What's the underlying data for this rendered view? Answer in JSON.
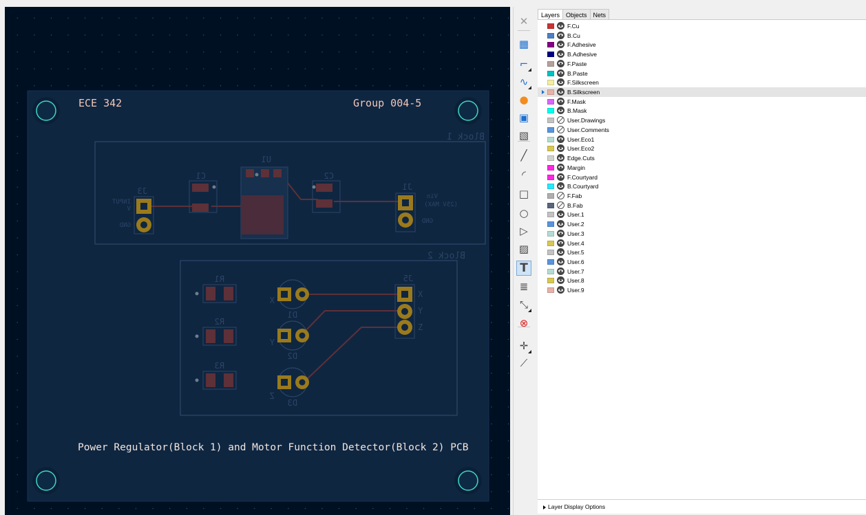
{
  "canvas": {
    "board": {
      "title_left": "ECE 342",
      "title_right": "Group 004-5",
      "footer": "Power Regulator(Block 1) and Motor Function Detector(Block 2) PCB",
      "block1_label": "Block 1",
      "block2_label": "Block 2",
      "refs": {
        "u1": "U1",
        "c1": "C1",
        "c2": "C2",
        "j3": "J3",
        "j1": "J1",
        "j5": "J5",
        "r1": "R1",
        "r2": "R2",
        "r3": "R3",
        "d1": "D1",
        "d2": "D2",
        "d3": "D3"
      },
      "pins": {
        "x": "X",
        "y": "Y",
        "z": "Z",
        "x_d1": "X",
        "y_d2": "Y",
        "z_d3": "Z"
      },
      "faint_labels": {
        "j3_input_1": "INPUT",
        "j3_input_2": "V",
        "j3_gnd": "GND",
        "j1_vin": "Vin",
        "j1_max": "(25V MAX)",
        "j1_gnd": "GND"
      }
    }
  },
  "toolbar": {
    "tools": [
      {
        "name": "select-tool-icon",
        "glyph": "✕"
      },
      {
        "name": "footprint-tool-icon",
        "glyph": "▦"
      },
      {
        "name": "route-track-tool-icon",
        "glyph": "⌐"
      },
      {
        "name": "tune-length-tool-icon",
        "glyph": "∿"
      },
      {
        "name": "via-tool-icon",
        "glyph": "●"
      },
      {
        "name": "rule-area-tool-icon",
        "glyph": "▣"
      },
      {
        "name": "zone-tool-icon",
        "glyph": "▧"
      },
      {
        "name": "line-tool-icon",
        "glyph": "╱"
      },
      {
        "name": "arc-tool-icon",
        "glyph": "◜"
      },
      {
        "name": "rectangle-tool-icon",
        "glyph": "□"
      },
      {
        "name": "circle-tool-icon",
        "glyph": "○"
      },
      {
        "name": "polygon-tool-icon",
        "glyph": "▷"
      },
      {
        "name": "image-tool-icon",
        "glyph": "▨"
      },
      {
        "name": "text-tool-icon",
        "glyph": "T"
      },
      {
        "name": "textbox-tool-icon",
        "glyph": "≣"
      },
      {
        "name": "dimension-tool-icon",
        "glyph": "⤡"
      },
      {
        "name": "delete-tool-icon",
        "glyph": "⊗"
      },
      {
        "name": "origin-tool-icon",
        "glyph": "✛"
      },
      {
        "name": "measure-tool-icon",
        "glyph": "⟋"
      }
    ]
  },
  "panel": {
    "tabs": [
      "Layers",
      "Objects",
      "Nets"
    ],
    "active_tab": "Layers",
    "selected_layer": "B.Silkscreen",
    "layers": [
      {
        "name": "F.Cu",
        "color": "#c83434",
        "visible": true
      },
      {
        "name": "B.Cu",
        "color": "#4d7fc4",
        "visible": true
      },
      {
        "name": "F.Adhesive",
        "color": "#840084",
        "visible": true
      },
      {
        "name": "B.Adhesive",
        "color": "#000084",
        "visible": true
      },
      {
        "name": "F.Paste",
        "color": "#b4a09c",
        "visible": true
      },
      {
        "name": "B.Paste",
        "color": "#00c2c2",
        "visible": true
      },
      {
        "name": "F.Silkscreen",
        "color": "#f2eda1",
        "visible": true
      },
      {
        "name": "B.Silkscreen",
        "color": "#e8b2a7",
        "visible": true
      },
      {
        "name": "F.Mask",
        "color": "#d864ff",
        "visible": true
      },
      {
        "name": "B.Mask",
        "color": "#02ffee",
        "visible": true
      },
      {
        "name": "User.Drawings",
        "color": "#c2c2c2",
        "visible": false
      },
      {
        "name": "User.Comments",
        "color": "#5994dc",
        "visible": false
      },
      {
        "name": "User.Eco1",
        "color": "#b4dbd2",
        "visible": true
      },
      {
        "name": "User.Eco2",
        "color": "#d8c852",
        "visible": true
      },
      {
        "name": "Edge.Cuts",
        "color": "#d0d2cd",
        "visible": true
      },
      {
        "name": "Margin",
        "color": "#ff26e2",
        "visible": true
      },
      {
        "name": "F.Courtyard",
        "color": "#ff26e2",
        "visible": true
      },
      {
        "name": "B.Courtyard",
        "color": "#26e9ff",
        "visible": true
      },
      {
        "name": "F.Fab",
        "color": "#afafaf",
        "visible": false
      },
      {
        "name": "B.Fab",
        "color": "#58657a",
        "visible": false
      },
      {
        "name": "User.1",
        "color": "#c2c2c2",
        "visible": true
      },
      {
        "name": "User.2",
        "color": "#5994dc",
        "visible": true
      },
      {
        "name": "User.3",
        "color": "#b4dbd2",
        "visible": true
      },
      {
        "name": "User.4",
        "color": "#d8c852",
        "visible": true
      },
      {
        "name": "User.5",
        "color": "#c2c2c2",
        "visible": true
      },
      {
        "name": "User.6",
        "color": "#5994dc",
        "visible": true
      },
      {
        "name": "User.7",
        "color": "#b4dbd2",
        "visible": true
      },
      {
        "name": "User.8",
        "color": "#d8c852",
        "visible": true
      },
      {
        "name": "User.9",
        "color": "#e8b2a7",
        "visible": true
      }
    ],
    "footer_label": "Layer Display Options"
  }
}
